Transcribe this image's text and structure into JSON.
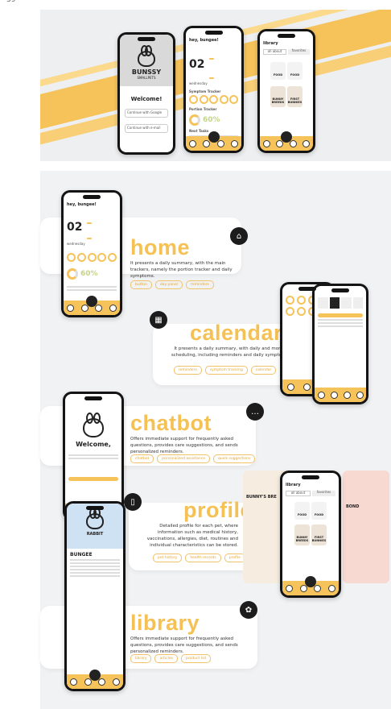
{
  "page_number": "39",
  "sections": [
    {
      "id": "home",
      "title": "home",
      "icon": "home-icon",
      "desc": "It presents a daily summary, with the main trackers, namely the portion tracker and daily symptoms.",
      "chips": [
        "button",
        "day panel",
        "reminders"
      ]
    },
    {
      "id": "calendar",
      "title": "calendar",
      "icon": "calendar-icon",
      "desc": "It presents a daily summary, with daily and monthly scheduling, including reminders and daily symptoms.",
      "chips": [
        "reminders",
        "symptom tracking",
        "calendar"
      ]
    },
    {
      "id": "chatbot",
      "title": "chatbot",
      "icon": "chat-icon",
      "desc": "Offers immediate support for frequently asked questions, provides care suggestions, and sends personalized reminders.",
      "chips": [
        "chatbot",
        "personalized assistance",
        "quick suggestions"
      ]
    },
    {
      "id": "profile",
      "title": "profile",
      "icon": "book-icon",
      "desc": "Detailed profile for each pet, where information such as medical history, vaccinations, allergies, diet, routines and individual characteristics can be stored.",
      "chips": [
        "pet history",
        "health records",
        "profile"
      ]
    },
    {
      "id": "library",
      "title": "library",
      "icon": "paw-icon",
      "desc": "Offers immediate support for frequently asked questions, provides care suggestions, and sends personalized reminders.",
      "chips": [
        "library",
        "articles",
        "product list"
      ]
    }
  ],
  "hero": {
    "welcome_phone": {
      "brand": "BUNSSY",
      "sub": "SMALLPETS",
      "welcome": "Welcome!",
      "btn1": "Continue with Google",
      "btn2": "Continue with e-mail"
    },
    "home_phone": {
      "greet": "hey, bungee!",
      "date": "02",
      "day": "wednesday",
      "label1": "Symptom Tracker",
      "label2": "Portion Tracker",
      "percent": "60%",
      "label3": "Next Tasks"
    },
    "library_phone": {
      "title": "library",
      "tab1": "all about",
      "tab2": "favorites",
      "food1": "FOOD",
      "food2": "FOOD",
      "item3": "BUNNY BREEDS",
      "item4": "FIRST BUNNIES"
    }
  },
  "chat_phone": {
    "welcome": "Welcome,"
  },
  "profile_phone": {
    "name": "BUNGEE",
    "breed": "RABBIT"
  },
  "bunny_label": "BUNNY'S BRE",
  "bond_label": "BOND"
}
